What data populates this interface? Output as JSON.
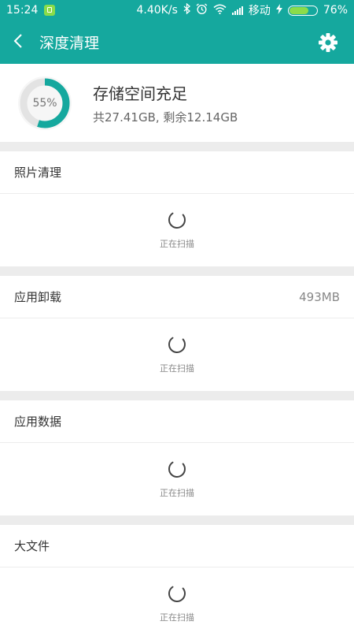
{
  "status_bar": {
    "time": "15:24",
    "network_speed": "4.40K/s",
    "carrier": "移动",
    "battery": "76%",
    "battery_level": 0.76,
    "icons": [
      "bluetooth-icon",
      "alarm-icon",
      "wifi-icon",
      "signal-icon",
      "charging-icon",
      "battery-icon"
    ]
  },
  "header": {
    "title": "深度清理",
    "back_icon": "back-arrow-icon",
    "settings_icon": "gear-icon"
  },
  "storage": {
    "percent_label": "55%",
    "percent_used": 0.55,
    "status": "存储空间充足",
    "detail": "共27.41GB, 剩余12.14GB"
  },
  "sections": [
    {
      "title": "照片清理",
      "value": "",
      "scan_text": "正在扫描"
    },
    {
      "title": "应用卸载",
      "value": "493MB",
      "scan_text": "正在扫描"
    },
    {
      "title": "应用数据",
      "value": "",
      "scan_text": "正在扫描"
    },
    {
      "title": "大文件",
      "value": "",
      "scan_text": "正在扫描"
    }
  ],
  "colors": {
    "accent": "#15a89e",
    "divider": "#ececec",
    "ring_track": "#e3e3e3"
  }
}
